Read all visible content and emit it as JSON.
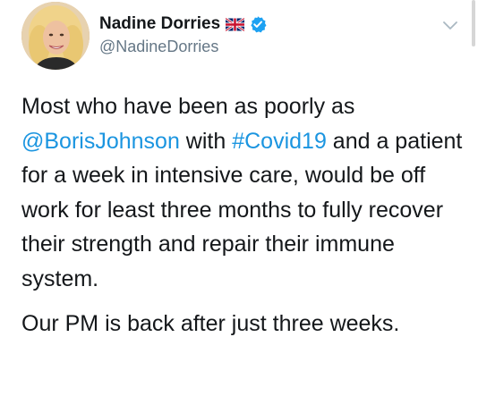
{
  "author": {
    "display_name": "Nadine Dorries",
    "handle": "@NadineDorries",
    "flag": "uk-flag-icon",
    "verified": true
  },
  "tweet": {
    "paragraph1": {
      "t1": "Most who have been as poorly as",
      "mention": "@BorisJohnson",
      "t2": " with ",
      "hashtag": "#Covid19",
      "t3": " and a patient for a week in intensive care, would be off work for least three months to fully recover their strength and repair their immune system."
    },
    "paragraph2": "Our PM is back after just three weeks."
  },
  "colors": {
    "link": "#1b95e0",
    "text": "#14171a",
    "secondary": "#657786",
    "verified": "#1da1f2"
  }
}
